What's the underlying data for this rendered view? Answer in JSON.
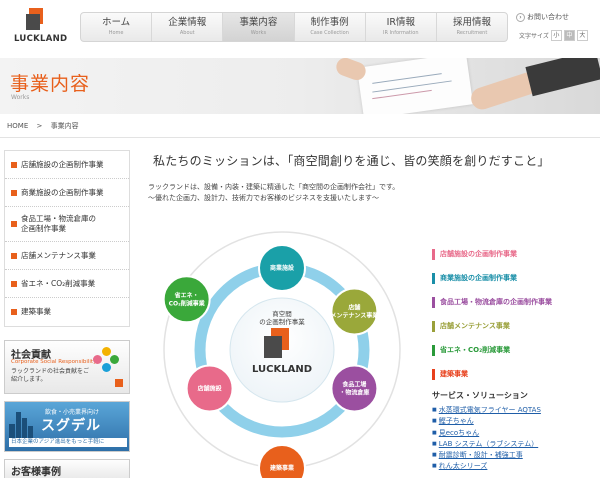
{
  "header": {
    "logo_text": "LUCKLAND",
    "nav": [
      {
        "jp": "ホーム",
        "en": "Home"
      },
      {
        "jp": "企業情報",
        "en": "About"
      },
      {
        "jp": "事業内容",
        "en": "Works"
      },
      {
        "jp": "制作事例",
        "en": "Case Collection"
      },
      {
        "jp": "IR情報",
        "en": "IR Information"
      },
      {
        "jp": "採用情報",
        "en": "Recruitment"
      }
    ],
    "contact": "お問い合わせ",
    "font_size_label": "文字サイズ",
    "font_sizes": [
      "小",
      "中",
      "大"
    ]
  },
  "banner": {
    "title": "事業内容",
    "subtitle": "Works"
  },
  "breadcrumb": {
    "home": "HOME",
    "sep": ">",
    "current": "事業内容"
  },
  "sidebar": {
    "items": [
      "店舗施設の企画制作事業",
      "商業施設の企画制作事業",
      "食品工場・物流倉庫の企画制作事業",
      "店舗メンテナンス事業",
      "省エネ・CO₂削減事業",
      "建築事業"
    ],
    "promo1": {
      "title": "社会貢献",
      "en": "Corporate Social Responsibility",
      "text": "ラックランドの社会貢献をご紹介します。"
    },
    "promo2": {
      "small": "飲食・小売業界向け",
      "big": "スグデル",
      "sub": "日本企業のアジア進出をもっと手軽に"
    },
    "promo3": {
      "title": "お客様事例"
    }
  },
  "main": {
    "mission": "私たちのミッションは、「商空間創りを通じ、皆の笑顔を創りだすこと」",
    "intro_1": "ラックランドは、設備・内装・建築に精通した「商空間の企画制作会社」です。",
    "intro_2": "〜優れた企画力、設計力、技術力でお客様のビジネスを支援いたします〜"
  },
  "diagram": {
    "center_label": "商空間の企画制作事業",
    "center_logo": "LUCKLAND",
    "nodes": [
      {
        "label": "商業施設",
        "color": "#1aa0a8"
      },
      {
        "label": "店舗メンテナンス事業",
        "color": "#9aa83a"
      },
      {
        "label": "食品工場・物流倉庫",
        "color": "#9b4fa0"
      },
      {
        "label": "建築事業",
        "color": "#e8601c"
      },
      {
        "label": "店舗施設",
        "color": "#e86a8a"
      },
      {
        "label": "省エネ・CO₂削減事業",
        "color": "#3aa83a"
      }
    ]
  },
  "legend": [
    {
      "label": "店舗施設の企画制作事業",
      "color": "#e86a8a"
    },
    {
      "label": "商業施設の企画制作事業",
      "color": "#1a8fa8"
    },
    {
      "label": "食品工場・物流倉庫の企画制作事業",
      "color": "#9b4fa0"
    },
    {
      "label": "店舗メンテナンス事業",
      "color": "#9aa03a"
    },
    {
      "label": "省エネ・CO₂削減事業",
      "color": "#2a9a3a"
    },
    {
      "label": "建築事業",
      "color": "#e8401c"
    }
  ],
  "services": {
    "title": "サービス・ソリューション",
    "items": [
      "水蒸環式電気フライヤー AQTAS",
      "鰹子ちゃん",
      "見ecoちゃん",
      "LAB システム（ラブシステム）",
      "耐震診断・設計・補強工事",
      "れん太シリーズ"
    ]
  },
  "colors": {
    "accent": "#e8601c",
    "link": "#1f5ea8",
    "diagram_ring": "#8fd0ea"
  }
}
